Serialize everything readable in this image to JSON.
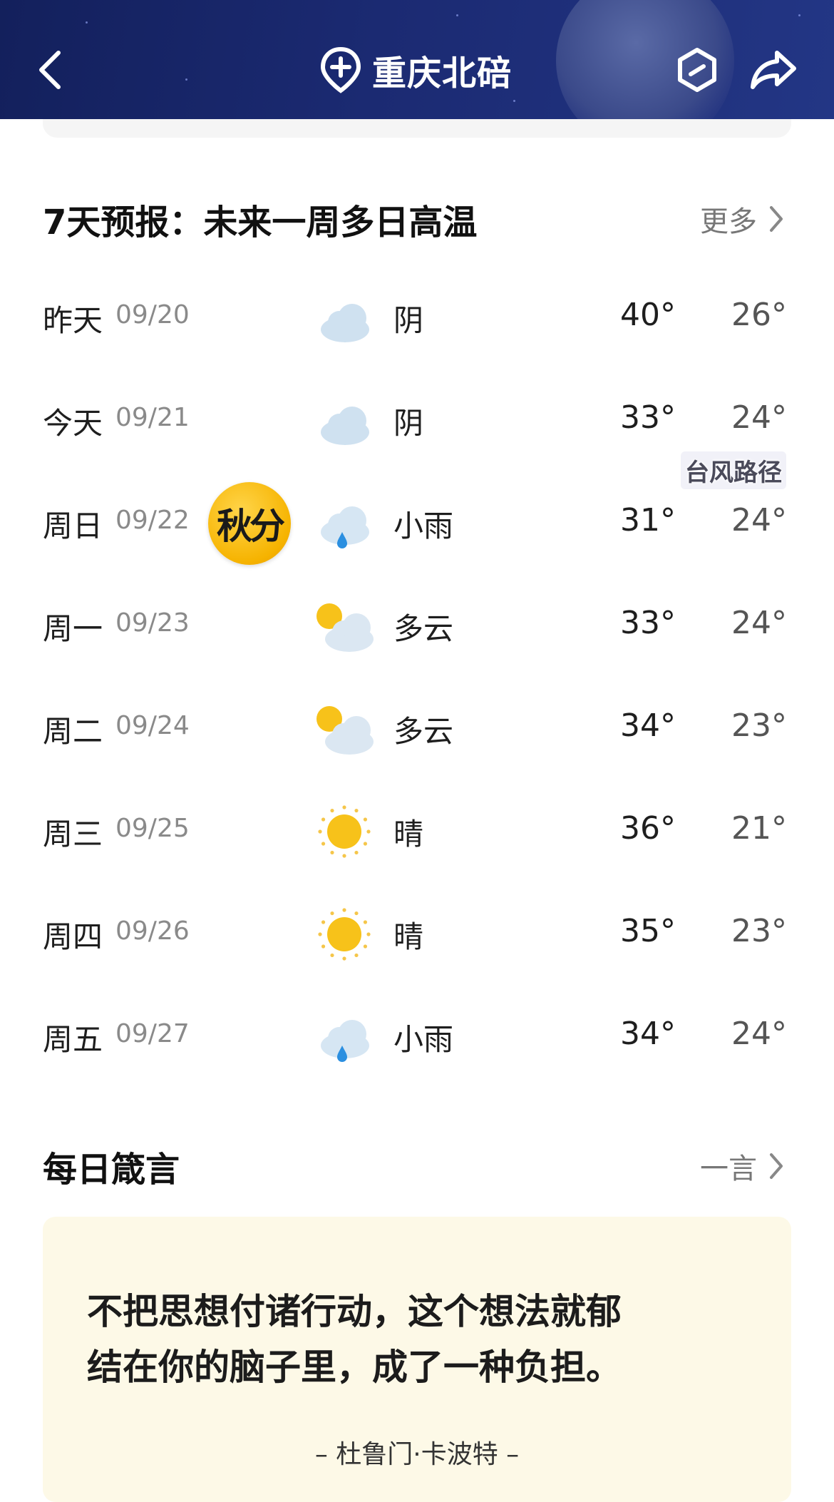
{
  "header": {
    "location": "重庆北碚",
    "icons": {
      "back": "chevron-left-icon",
      "location": "location-add-icon",
      "style": "hexagon-icon",
      "share": "share-arrow-icon"
    }
  },
  "forecast": {
    "title": "7天预报：未来一周多日高温",
    "more_label": "更多",
    "typhoon_label": "台风路径",
    "festival_badge": "秋分",
    "days": [
      {
        "day": "昨天",
        "date": "09/20",
        "icon": "cloudy-icon",
        "condition": "阴",
        "high": "40°",
        "low": "26°"
      },
      {
        "day": "今天",
        "date": "09/21",
        "icon": "cloudy-icon",
        "condition": "阴",
        "high": "33°",
        "low": "24°"
      },
      {
        "day": "周日",
        "date": "09/22",
        "icon": "light-rain-icon",
        "condition": "小雨",
        "high": "31°",
        "low": "24°"
      },
      {
        "day": "周一",
        "date": "09/23",
        "icon": "partly-cloudy-icon",
        "condition": "多云",
        "high": "33°",
        "low": "24°"
      },
      {
        "day": "周二",
        "date": "09/24",
        "icon": "partly-cloudy-icon",
        "condition": "多云",
        "high": "34°",
        "low": "23°"
      },
      {
        "day": "周三",
        "date": "09/25",
        "icon": "sunny-icon",
        "condition": "晴",
        "high": "36°",
        "low": "21°"
      },
      {
        "day": "周四",
        "date": "09/26",
        "icon": "sunny-icon",
        "condition": "晴",
        "high": "35°",
        "low": "23°"
      },
      {
        "day": "周五",
        "date": "09/27",
        "icon": "light-rain-icon",
        "condition": "小雨",
        "high": "34°",
        "low": "24°"
      }
    ]
  },
  "quote": {
    "title": "每日箴言",
    "link_label": "一言",
    "lines": [
      "不把思想付诸行动，这个想法就郁",
      "结在你的脑子里，成了一种负担。"
    ],
    "author": "– 杜鲁门·卡波特 –"
  },
  "colors": {
    "header_bg": "#1b2a72",
    "quote_bg": "#fdf9e7",
    "sun": "#f7c21a",
    "rain_drop": "#2b8fe0"
  }
}
